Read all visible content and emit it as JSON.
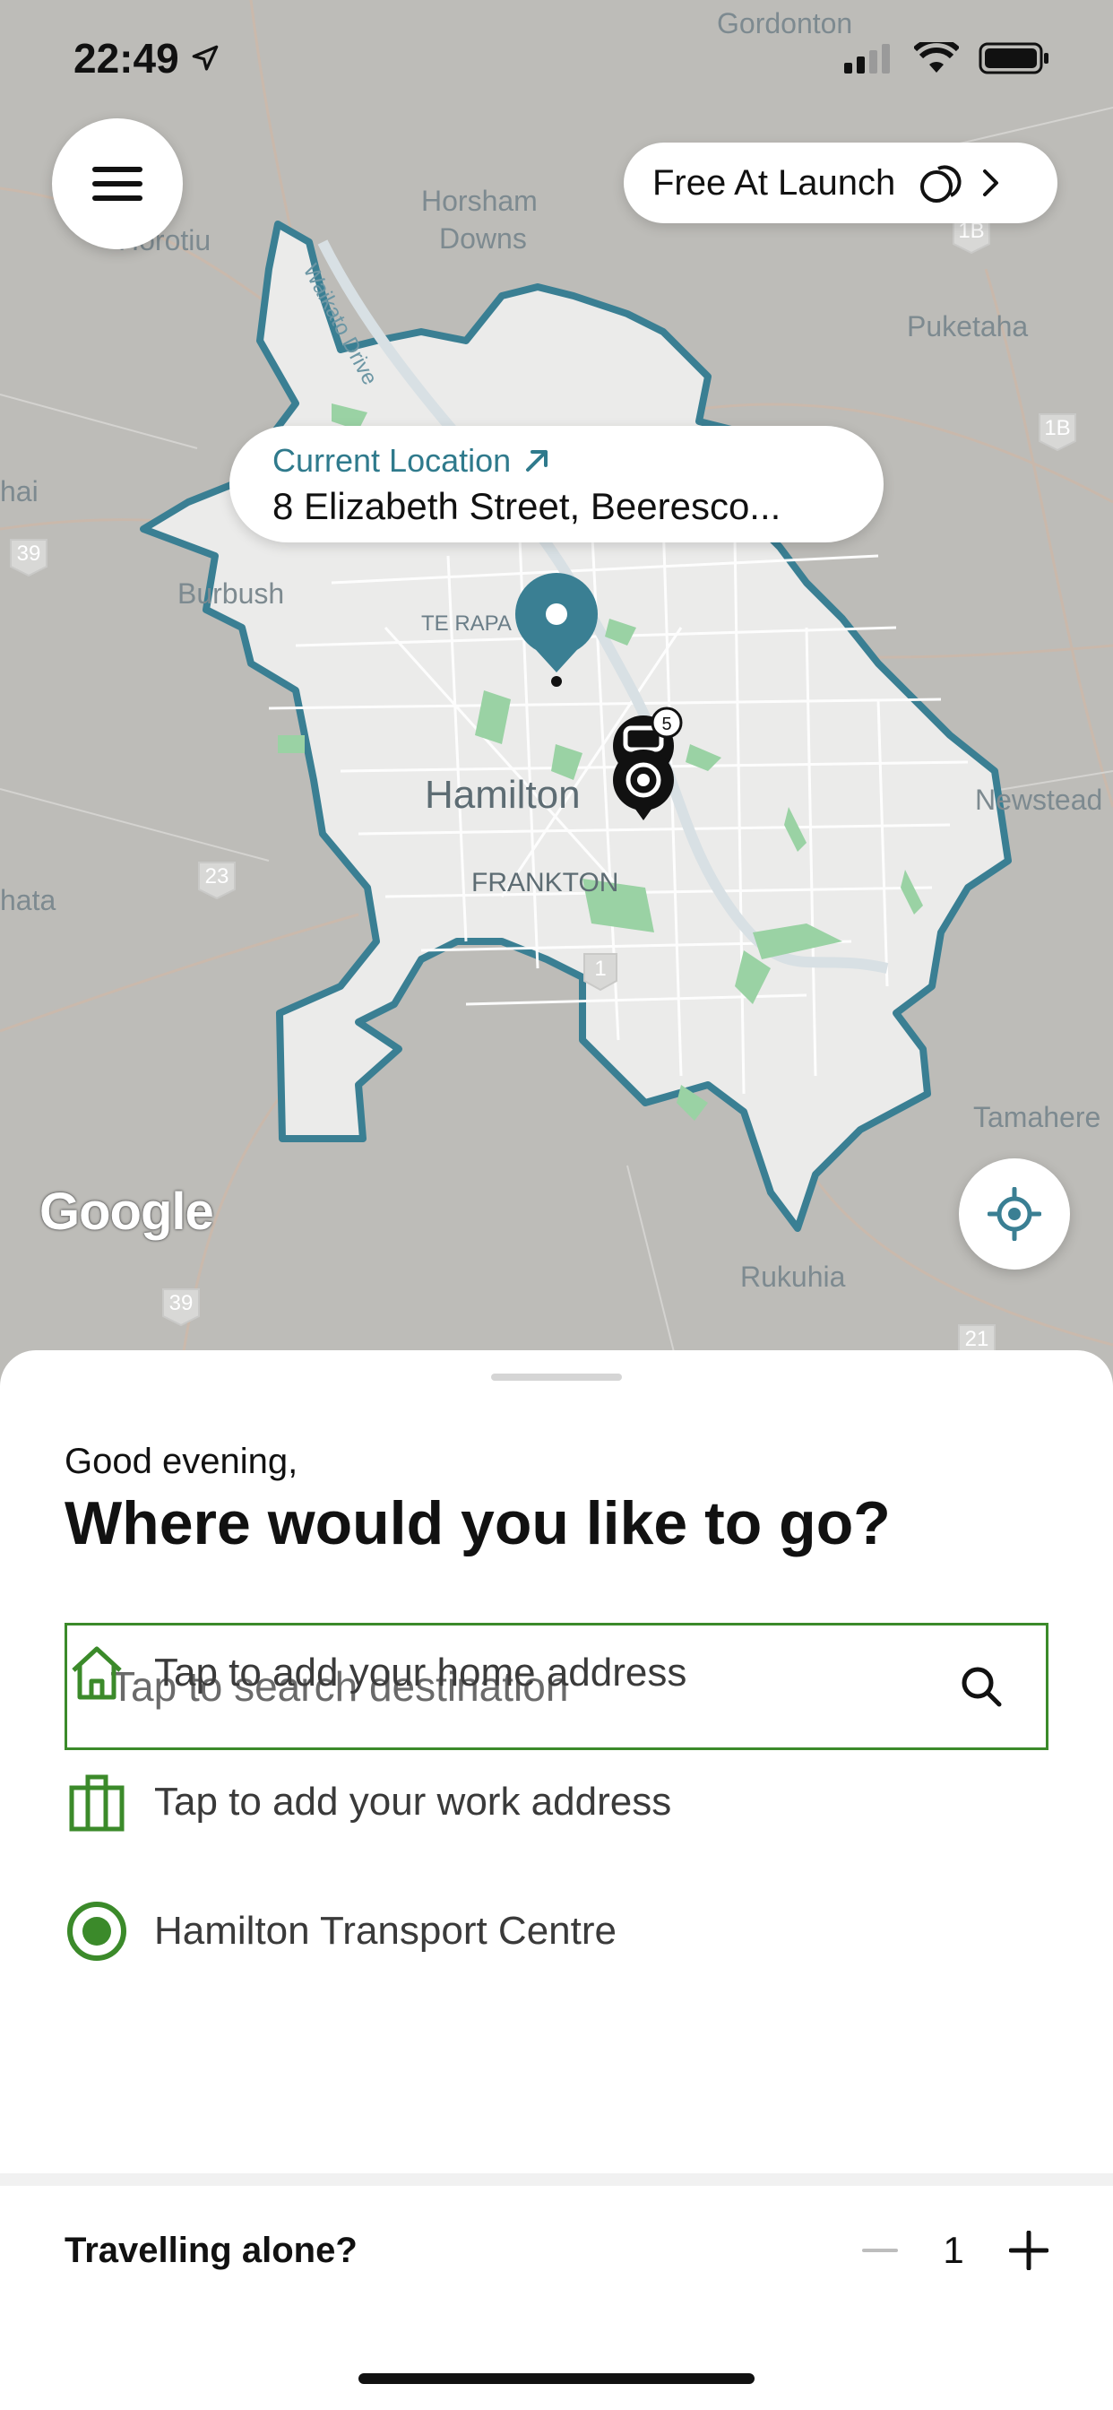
{
  "status_bar": {
    "time": "22:49"
  },
  "map": {
    "labels": {
      "gordonton": "Gordonton",
      "horsham": "Horsham",
      "downs": "Downs",
      "horotiu": "Horotiu",
      "puketaha": "Puketaha",
      "hai": "hai",
      "burbush": "Burbush",
      "te_rapa": "TE RAPA",
      "hamilton": "Hamilton",
      "frankton": "FRANKTON",
      "newstead": "Newstead",
      "hata": "hata",
      "tamahere": "Tamahere",
      "rukuhia": "Rukuhia",
      "waikato_drive": "Waikato Drive"
    },
    "road_shields": [
      "1B",
      "1B",
      "39",
      "23",
      "1",
      "39",
      "21"
    ],
    "vehicle_badge": "5",
    "attribution": "Google",
    "service_area_color": "#3a7f93",
    "pin_color": "#3a7f93"
  },
  "header": {
    "menu_icon": "hamburger-menu-icon",
    "promo_label": "Free At Launch"
  },
  "location_bubble": {
    "title": "Current Location",
    "address": "8 Elizabeth Street, Beeresco..."
  },
  "sheet": {
    "greeting": "Good evening,",
    "headline": "Where would you like to go?",
    "search_placeholder": "Tap to search destination",
    "home_label": "Tap to add your home address",
    "work_label": "Tap to add your work address",
    "place_label": "Hamilton Transport Centre",
    "travelling_label": "Travelling alone?",
    "passenger_count": "1",
    "accent_color": "#3b8a2a"
  }
}
